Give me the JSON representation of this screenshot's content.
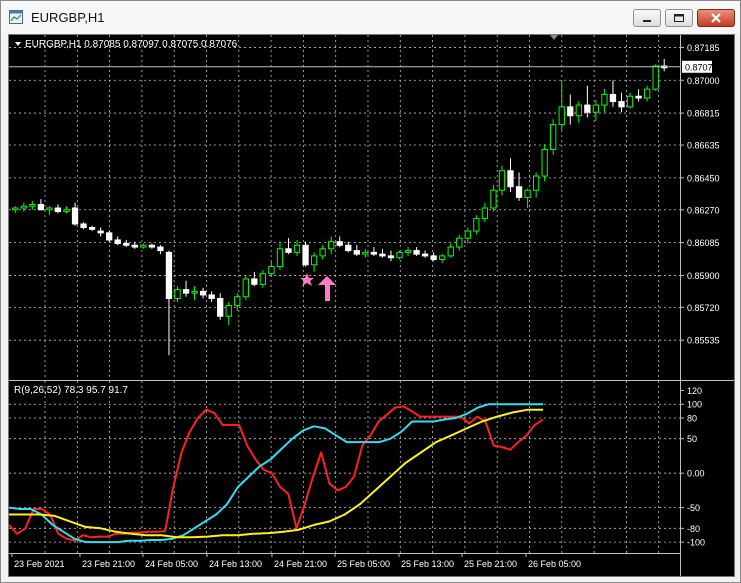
{
  "window": {
    "title": "EURGBP,H1",
    "buttons": [
      "minimize",
      "maximize",
      "close"
    ]
  },
  "main_chart": {
    "header": "EURGBP,H1  0.87085 0.87097 0.87075 0.87076",
    "price_tag": "0.87076",
    "signal_marker": "pink-up-arrow",
    "colors": {
      "background": "#000000",
      "grid": "#c0c0c0",
      "bull": "#00ff00",
      "bear": "#ffffff"
    }
  },
  "indicator": {
    "label": "R(9,26,52) 78.3 95.7 91.7",
    "colors": {
      "fast": "#ff2020",
      "medium": "#33ddee",
      "slow": "#ffee22"
    }
  },
  "chart_data": [
    {
      "type": "candlestick",
      "title": "EURGBP,H1",
      "ylim": [
        0.8535,
        0.8721
      ],
      "y_ticks": [
        "0.87185",
        "0.87000",
        "0.86815",
        "0.86635",
        "0.86450",
        "0.86270",
        "0.86085",
        "0.85900",
        "0.85720",
        "0.85535"
      ],
      "x_ticks": [
        "23 Feb 2021",
        "23 Feb 21:00",
        "24 Feb 05:00",
        "24 Feb 13:00",
        "24 Feb 21:00",
        "25 Feb 05:00",
        "25 Feb 13:00",
        "25 Feb 21:00",
        "26 Feb 05:00"
      ],
      "last_price": 0.87076,
      "candles": [
        [
          0.8627,
          0.8629,
          0.8625,
          0.8628
        ],
        [
          0.8628,
          0.8631,
          0.8626,
          0.8629
        ],
        [
          0.8629,
          0.8632,
          0.8627,
          0.863
        ],
        [
          0.863,
          0.8633,
          0.8628,
          0.8627
        ],
        [
          0.8627,
          0.8629,
          0.8624,
          0.8628
        ],
        [
          0.8628,
          0.863,
          0.8625,
          0.8626
        ],
        [
          0.8626,
          0.8629,
          0.8625,
          0.8627
        ],
        [
          0.8628,
          0.8631,
          0.8618,
          0.8619
        ],
        [
          0.8619,
          0.862,
          0.8616,
          0.8617
        ],
        [
          0.8617,
          0.8618,
          0.8615,
          0.8616
        ],
        [
          0.8615,
          0.8617,
          0.8612,
          0.8614
        ],
        [
          0.8614,
          0.8615,
          0.8609,
          0.861
        ],
        [
          0.861,
          0.8612,
          0.8607,
          0.8608
        ],
        [
          0.8608,
          0.861,
          0.8606,
          0.8607
        ],
        [
          0.8607,
          0.8609,
          0.8605,
          0.8606
        ],
        [
          0.8606,
          0.8608,
          0.8605,
          0.8607
        ],
        [
          0.8607,
          0.8608,
          0.8605,
          0.8606
        ],
        [
          0.8606,
          0.8607,
          0.8602,
          0.8604
        ],
        [
          0.8603,
          0.8604,
          0.8545,
          0.8577
        ],
        [
          0.8577,
          0.8584,
          0.8575,
          0.8582
        ],
        [
          0.8582,
          0.8587,
          0.8578,
          0.858
        ],
        [
          0.858,
          0.8584,
          0.8576,
          0.8581
        ],
        [
          0.8581,
          0.8583,
          0.8577,
          0.8579
        ],
        [
          0.8579,
          0.8581,
          0.8575,
          0.8577
        ],
        [
          0.8577,
          0.858,
          0.8565,
          0.8567
        ],
        [
          0.8567,
          0.8575,
          0.8562,
          0.8573
        ],
        [
          0.8573,
          0.858,
          0.857,
          0.8578
        ],
        [
          0.8578,
          0.859,
          0.8576,
          0.8588
        ],
        [
          0.8588,
          0.8592,
          0.8584,
          0.8585
        ],
        [
          0.8585,
          0.8593,
          0.8583,
          0.8591
        ],
        [
          0.8591,
          0.8598,
          0.8589,
          0.8595
        ],
        [
          0.8595,
          0.8609,
          0.8593,
          0.8605
        ],
        [
          0.8605,
          0.8611,
          0.8602,
          0.8603
        ],
        [
          0.8603,
          0.861,
          0.8601,
          0.8607
        ],
        [
          0.8607,
          0.8609,
          0.8595,
          0.8596
        ],
        [
          0.8596,
          0.8603,
          0.8592,
          0.8601
        ],
        [
          0.8601,
          0.8607,
          0.8599,
          0.8605
        ],
        [
          0.8605,
          0.8612,
          0.8602,
          0.8609
        ],
        [
          0.8609,
          0.8612,
          0.8606,
          0.8607
        ],
        [
          0.8607,
          0.8609,
          0.8603,
          0.8604
        ],
        [
          0.8604,
          0.8607,
          0.8601,
          0.8602
        ],
        [
          0.8602,
          0.8605,
          0.86,
          0.8603
        ],
        [
          0.8603,
          0.8606,
          0.8601,
          0.8602
        ],
        [
          0.8602,
          0.8605,
          0.86,
          0.8601
        ],
        [
          0.8601,
          0.8604,
          0.8598,
          0.86
        ],
        [
          0.86,
          0.8604,
          0.8599,
          0.8603
        ],
        [
          0.8603,
          0.8606,
          0.8601,
          0.8604
        ],
        [
          0.8604,
          0.8606,
          0.8601,
          0.8602
        ],
        [
          0.8602,
          0.8604,
          0.86,
          0.8601
        ],
        [
          0.8601,
          0.8603,
          0.8598,
          0.8599
        ],
        [
          0.8599,
          0.8602,
          0.8597,
          0.8601
        ],
        [
          0.8601,
          0.8608,
          0.86,
          0.8606
        ],
        [
          0.8606,
          0.8613,
          0.8604,
          0.8611
        ],
        [
          0.8611,
          0.8617,
          0.8608,
          0.8615
        ],
        [
          0.8615,
          0.8624,
          0.8613,
          0.8622
        ],
        [
          0.8622,
          0.8631,
          0.862,
          0.8628
        ],
        [
          0.8628,
          0.8641,
          0.8626,
          0.8638
        ],
        [
          0.8638,
          0.8652,
          0.8635,
          0.8649
        ],
        [
          0.8649,
          0.8656,
          0.8637,
          0.864
        ],
        [
          0.864,
          0.8648,
          0.8632,
          0.8634
        ],
        [
          0.8634,
          0.8639,
          0.8628,
          0.8638
        ],
        [
          0.8638,
          0.8648,
          0.8634,
          0.8646
        ],
        [
          0.8646,
          0.8664,
          0.8643,
          0.8661
        ],
        [
          0.8661,
          0.8678,
          0.8658,
          0.8675
        ],
        [
          0.8675,
          0.87,
          0.8672,
          0.8685
        ],
        [
          0.8685,
          0.8692,
          0.8675,
          0.868
        ],
        [
          0.868,
          0.8688,
          0.8676,
          0.8686
        ],
        [
          0.8686,
          0.8697,
          0.8679,
          0.8682
        ],
        [
          0.8682,
          0.8689,
          0.8677,
          0.8686
        ],
        [
          0.8686,
          0.8695,
          0.8682,
          0.8692
        ],
        [
          0.8692,
          0.87,
          0.8685,
          0.8688
        ],
        [
          0.8688,
          0.8693,
          0.8682,
          0.8685
        ],
        [
          0.8685,
          0.8693,
          0.8684,
          0.8691
        ],
        [
          0.8691,
          0.8695,
          0.8688,
          0.869
        ],
        [
          0.869,
          0.8697,
          0.8688,
          0.8695
        ],
        [
          0.8695,
          0.8709,
          0.8694,
          0.8708
        ],
        [
          0.8708,
          0.8712,
          0.8705,
          0.8707
        ]
      ],
      "signal_candle_index": 44
    },
    {
      "type": "line",
      "title": "R(9,26,52)",
      "ylim": [
        -110,
        125
      ],
      "y_ticks": [
        120,
        100,
        80,
        50,
        0.0,
        -50,
        -80,
        -100
      ],
      "series": [
        {
          "name": "R9",
          "values": [
            -75,
            -88,
            -80,
            -52,
            -52,
            -60,
            -88,
            -95,
            -98,
            -90,
            -93,
            -92,
            -92,
            -88,
            -88,
            -86,
            -86,
            -85,
            -85,
            -84,
            -20,
            30,
            60,
            80,
            92,
            87,
            70,
            70,
            70,
            40,
            20,
            5,
            0,
            -20,
            -30,
            -80,
            -45,
            -5,
            30,
            -15,
            -25,
            -20,
            -5,
            40,
            55,
            75,
            85,
            95,
            97,
            90,
            82,
            82,
            82,
            82,
            82,
            82,
            72,
            82,
            75,
            40,
            38,
            34,
            45,
            55,
            70,
            78
          ]
        },
        {
          "name": "R26",
          "values": [
            -50,
            -52,
            -52,
            -60,
            -75,
            -85,
            -95,
            -100,
            -100,
            -100,
            -100,
            -98,
            -98,
            -97,
            -97,
            -95,
            -90,
            -80,
            -70,
            -60,
            -45,
            -20,
            -5,
            10,
            20,
            35,
            50,
            62,
            68,
            65,
            55,
            45,
            45,
            45,
            45,
            50,
            60,
            75,
            75,
            75,
            78,
            80,
            86,
            95,
            100,
            100,
            100,
            100,
            100,
            100
          ]
        },
        {
          "name": "R52",
          "values": [
            -60,
            -60,
            -60,
            -62,
            -70,
            -78,
            -80,
            -85,
            -88,
            -90,
            -90,
            -93,
            -93,
            -92,
            -90,
            -90,
            -88,
            -87,
            -85,
            -82,
            -75,
            -70,
            -60,
            -45,
            -25,
            -5,
            15,
            30,
            45,
            55,
            65,
            75,
            82,
            88,
            92,
            92
          ]
        }
      ]
    }
  ]
}
